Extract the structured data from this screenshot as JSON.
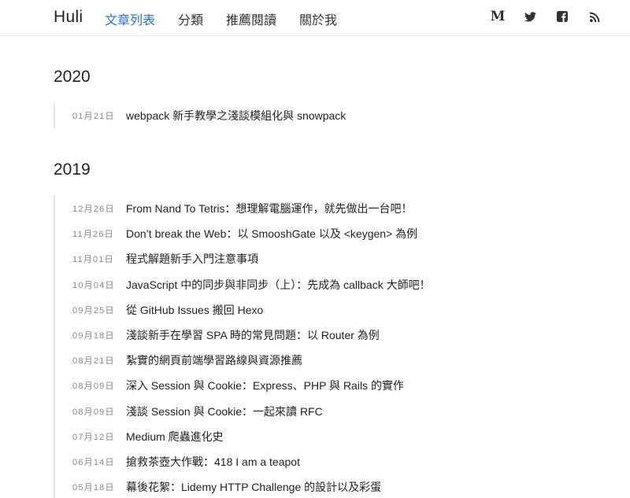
{
  "header": {
    "brand": "Huli",
    "nav": [
      {
        "label": "文章列表",
        "active": true
      },
      {
        "label": "分類",
        "active": false
      },
      {
        "label": "推薦閱讀",
        "active": false
      },
      {
        "label": "關於我",
        "active": false
      }
    ],
    "social_icons": [
      "medium-icon",
      "twitter-icon",
      "facebook-icon",
      "rss-icon"
    ],
    "medium_glyph": "M"
  },
  "archive": [
    {
      "year": "2020",
      "posts": [
        {
          "date": "01月21日",
          "title": "webpack 新手教學之淺談模組化與 snowpack"
        }
      ]
    },
    {
      "year": "2019",
      "posts": [
        {
          "date": "12月26日",
          "title": "From Nand To Tetris：想理解電腦運作，就先做出一台吧！"
        },
        {
          "date": "11月26日",
          "title": "Don’t break the Web：以 SmooshGate 以及 <keygen> 為例"
        },
        {
          "date": "11月01日",
          "title": "程式解題新手入門注意事項"
        },
        {
          "date": "10月04日",
          "title": "JavaScript 中的同步與非同步（上）：先成為 callback 大師吧！"
        },
        {
          "date": "09月25日",
          "title": "從 GitHub Issues 搬回 Hexo"
        },
        {
          "date": "09月18日",
          "title": "淺談新手在學習 SPA 時的常見問題：以 Router 為例"
        },
        {
          "date": "08月21日",
          "title": "紮實的網頁前端學習路線與資源推薦"
        },
        {
          "date": "08月09日",
          "title": "深入 Session 與 Cookie：Express、PHP 與 Rails 的實作"
        },
        {
          "date": "08月09日",
          "title": "淺談 Session 與 Cookie：一起來讀 RFC"
        },
        {
          "date": "07月12日",
          "title": "Medium 爬蟲進化史"
        },
        {
          "date": "06月14日",
          "title": "搶救茶壺大作戰：418 I am a teapot"
        },
        {
          "date": "05月18日",
          "title": "幕後花絮：Lidemy HTTP Challenge 的設計以及彩蛋"
        }
      ]
    }
  ],
  "colors": {
    "accent": "#2a6fc9",
    "text": "#222222",
    "muted": "#888888",
    "rule": "#e3e3e3"
  }
}
